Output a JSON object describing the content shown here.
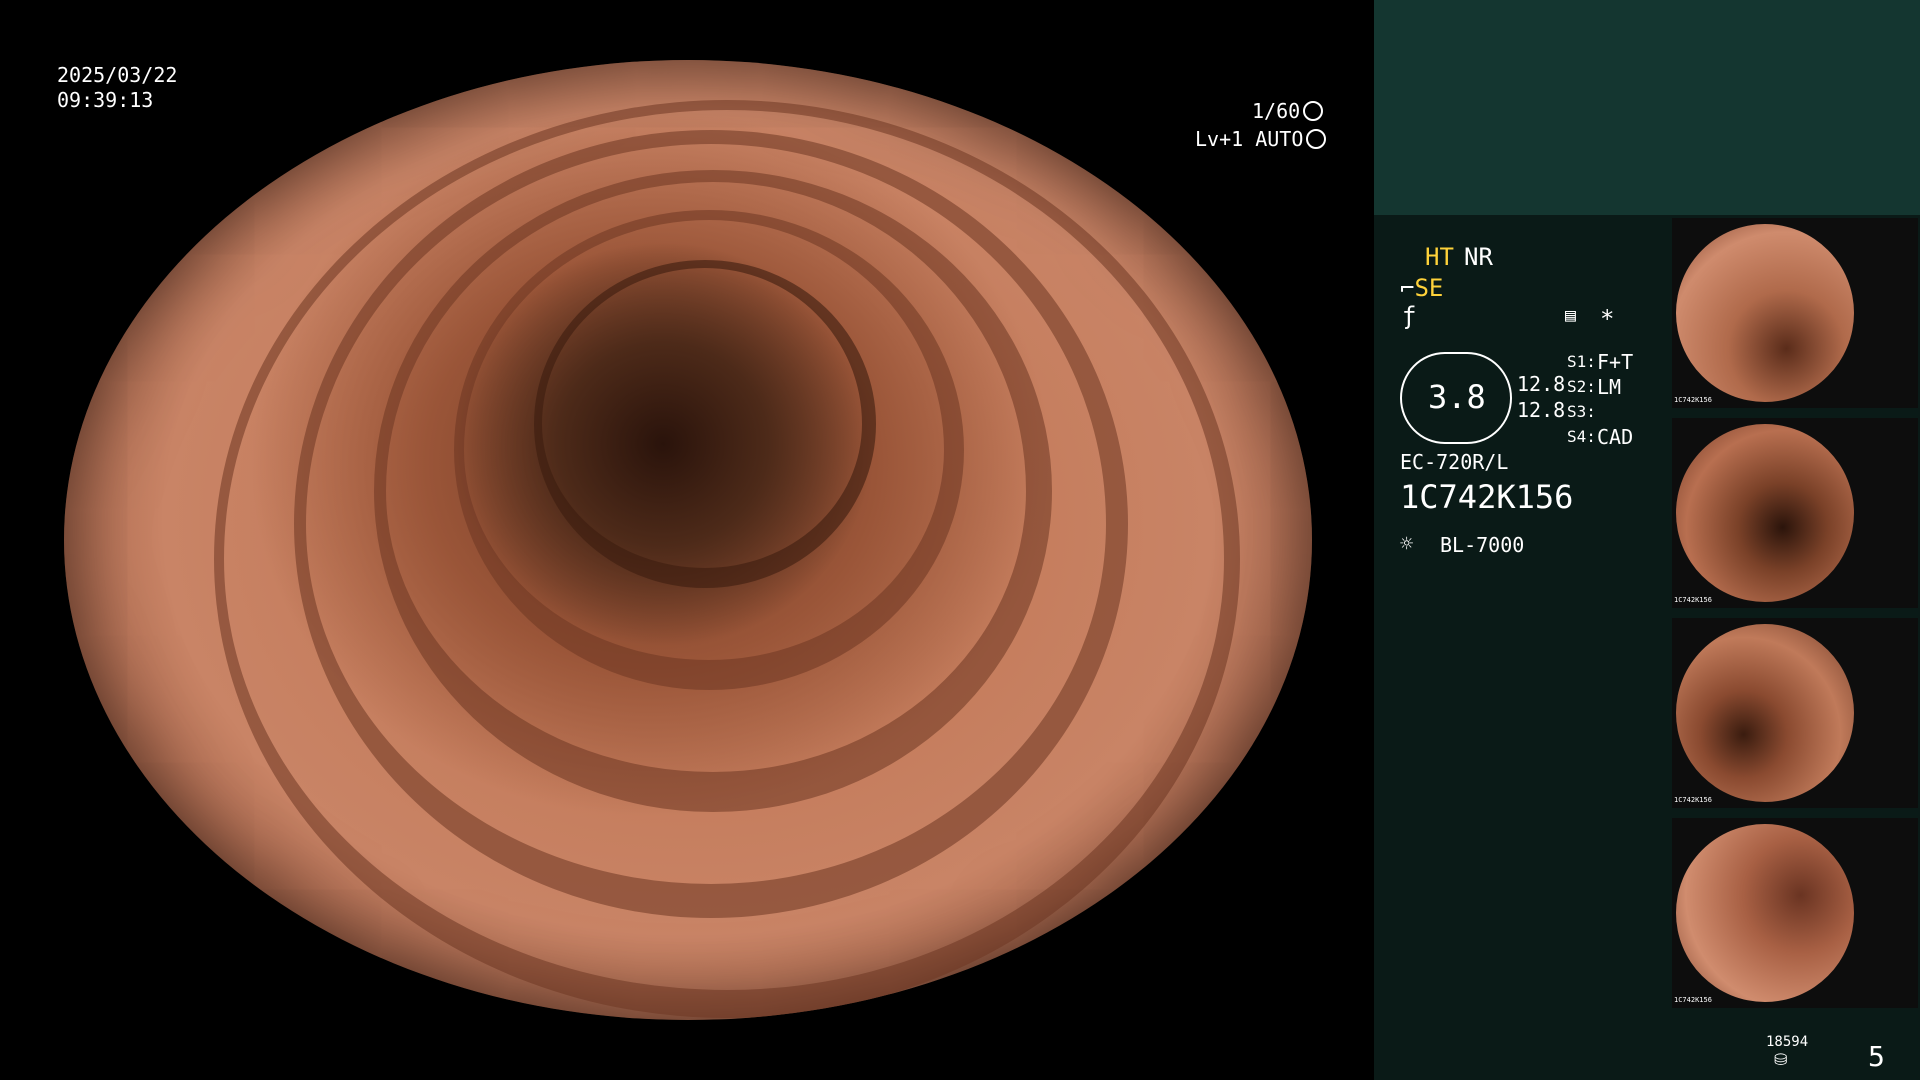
{
  "overlay": {
    "date": "2025/03/22",
    "time": "09:39:13",
    "shutter": "1/60",
    "level": "Lv+1",
    "mode": "AUTO"
  },
  "side_panel": {
    "ht": "HT",
    "nr": "NR",
    "se": "SE",
    "dial_value": "3.8",
    "val_1": "12.8",
    "val_2": "12.8",
    "s1_label": "S1:",
    "s1_value": "F+T",
    "s2_label": "S2:",
    "s2_value": "LM",
    "s3_label": "S3:",
    "s3_value": "",
    "s4_label": "S4:",
    "s4_value": "CAD",
    "model": "EC-720R/L",
    "serial": "1C742K156",
    "light_source": "BL-7000",
    "storage_count": "18594",
    "image_count": "5"
  },
  "thumbnails": [
    {
      "serial": "1C742K156"
    },
    {
      "serial": "1C742K156"
    },
    {
      "serial": "1C742K156"
    },
    {
      "serial": "1C742K156"
    }
  ],
  "colors": {
    "accent_yellow": "#ffd23a",
    "panel_top": "#143630",
    "panel_bg": "#0a1a17"
  }
}
